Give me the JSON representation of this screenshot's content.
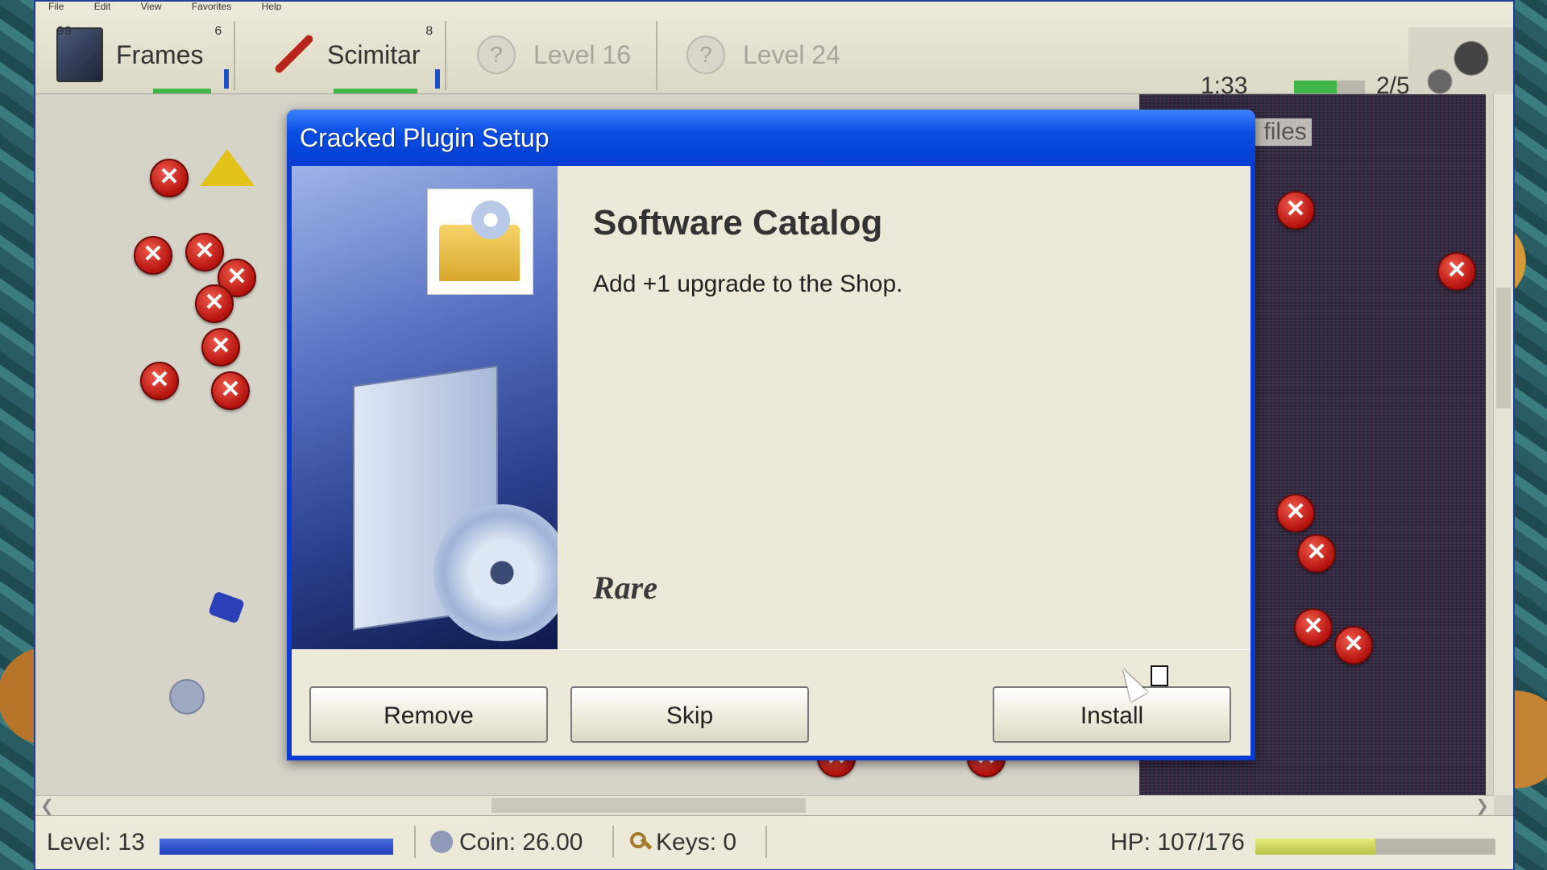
{
  "menu": [
    "File",
    "Edit",
    "View",
    "Favorites",
    "Help"
  ],
  "toolbar": {
    "items": [
      {
        "label": "Frames",
        "badge_left": "99",
        "badge_right": "6",
        "icon": "monitor-icon"
      },
      {
        "label": "Scimitar",
        "badge_right": "8",
        "icon": "scimitar-icon"
      },
      {
        "label": "Level 16",
        "icon": "question-icon",
        "locked": true
      },
      {
        "label": "Level 24",
        "icon": "question-icon",
        "locked": true
      }
    ],
    "timer": "1:33",
    "timer_fill_fraction": 0.6,
    "wave": "2/5"
  },
  "playfield": {
    "objective_text": "en 3/8 .dll files",
    "enemy_glyph": "✕"
  },
  "dialog": {
    "title": "Cracked Plugin Setup",
    "heading": "Software Catalog",
    "description": "Add +1 upgrade to the Shop.",
    "rarity": "Rare",
    "buttons": {
      "remove": "Remove",
      "skip": "Skip",
      "install": "Install"
    }
  },
  "status": {
    "level": "Level: 13",
    "level_fill_fraction": 1.0,
    "coin": "Coin: 26.00",
    "keys": "Keys: 0",
    "hp": "HP: 107/176",
    "hp_fill_fraction": 0.5
  },
  "colors": {
    "title_bar": "#0a3cd4",
    "enemy": "#c2211a",
    "hp_bar": "#d4dc62",
    "xp_bar": "#2a4fd0",
    "timer_bar": "#3fb54a"
  }
}
